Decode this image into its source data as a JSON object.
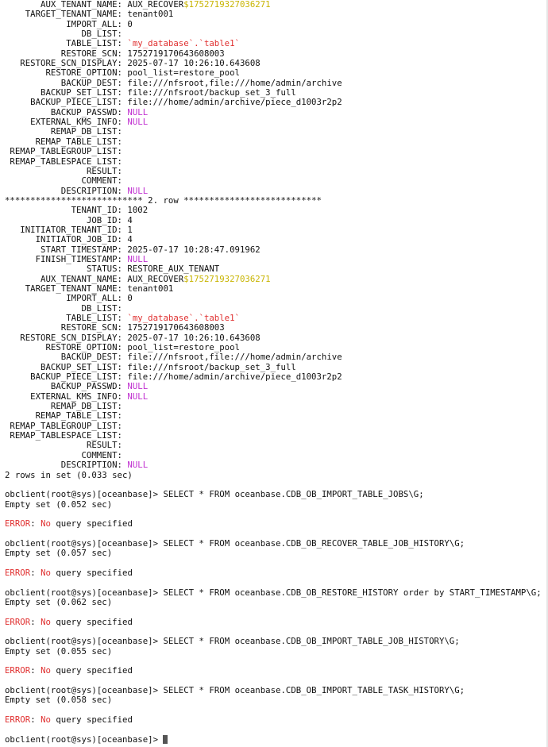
{
  "terminal": {
    "row_sep_left": "***************************",
    "row_sep_right": "***************************",
    "row_label": "2. row",
    "rows_in_set": "2 rows in set (0.033 sec)",
    "empty_label": "Empty set",
    "error_label": "ERROR",
    "error_tail_no": "No",
    "error_tail_rest": "query specified",
    "prompt": "obclient(root@sys)[oceanbase]>",
    "block1": [
      {
        "k": "AUX_TENANT_NAME:",
        "v": "AUX_RECOVER",
        "v2": "$1752719327036271"
      },
      {
        "k": "TARGET_TENANT_NAME:",
        "v": "tenant001"
      },
      {
        "k": "IMPORT_ALL:",
        "v": "0"
      },
      {
        "k": "DB_LIST:",
        "v": ""
      },
      {
        "k": "TABLE_LIST:",
        "v": "`my_database`.`table1`",
        "style": "red"
      },
      {
        "k": "RESTORE_SCN:",
        "v": "1752719170643608003"
      },
      {
        "k": "RESTORE_SCN_DISPLAY:",
        "v": "2025-07-17 10:26:10.643608"
      },
      {
        "k": "RESTORE_OPTION:",
        "v": "pool_list=restore_pool"
      },
      {
        "k": "BACKUP_DEST:",
        "v": "file:///nfsroot,file:///home/admin/archive"
      },
      {
        "k": "BACKUP_SET_LIST:",
        "v": "file:///nfsroot/backup_set_3_full"
      },
      {
        "k": "BACKUP_PIECE_LIST:",
        "v": "file:///home/admin/archive/piece_d1003r2p2"
      },
      {
        "k": "BACKUP_PASSWD:",
        "v": "NULL",
        "style": "mag"
      },
      {
        "k": "EXTERNAL_KMS_INFO:",
        "v": "NULL",
        "style": "mag"
      },
      {
        "k": "REMAP_DB_LIST:",
        "v": ""
      },
      {
        "k": "REMAP_TABLE_LIST:",
        "v": ""
      },
      {
        "k": "REMAP_TABLEGROUP_LIST:",
        "v": ""
      },
      {
        "k": "REMAP_TABLESPACE_LIST:",
        "v": ""
      },
      {
        "k": "RESULT:",
        "v": ""
      },
      {
        "k": "COMMENT:",
        "v": ""
      },
      {
        "k": "DESCRIPTION:",
        "v": "NULL",
        "style": "mag"
      }
    ],
    "block2": [
      {
        "k": "TENANT_ID:",
        "v": "1002"
      },
      {
        "k": "JOB_ID:",
        "v": "4"
      },
      {
        "k": "INITIATOR_TENANT_ID:",
        "v": "1"
      },
      {
        "k": "INITIATOR_JOB_ID:",
        "v": "4"
      },
      {
        "k": "START_TIMESTAMP:",
        "v": "2025-07-17 10:28:47.091962"
      },
      {
        "k": "FINISH_TIMESTAMP:",
        "v": "NULL",
        "style": "mag"
      },
      {
        "k": "STATUS:",
        "v": "RESTORE_AUX_TENANT"
      },
      {
        "k": "AUX_TENANT_NAME:",
        "v": "AUX_RECOVER",
        "v2": "$1752719327036271"
      },
      {
        "k": "TARGET_TENANT_NAME:",
        "v": "tenant001"
      },
      {
        "k": "IMPORT_ALL:",
        "v": "0"
      },
      {
        "k": "DB_LIST:",
        "v": ""
      },
      {
        "k": "TABLE_LIST:",
        "v": "`my_database`.`table1`",
        "style": "red"
      },
      {
        "k": "RESTORE_SCN:",
        "v": "1752719170643608003"
      },
      {
        "k": "RESTORE_SCN_DISPLAY:",
        "v": "2025-07-17 10:26:10.643608"
      },
      {
        "k": "RESTORE_OPTION:",
        "v": "pool_list=restore_pool"
      },
      {
        "k": "BACKUP_DEST:",
        "v": "file:///nfsroot,file:///home/admin/archive"
      },
      {
        "k": "BACKUP_SET_LIST:",
        "v": "file:///nfsroot/backup_set_3_full"
      },
      {
        "k": "BACKUP_PIECE_LIST:",
        "v": "file:///home/admin/archive/piece_d1003r2p2"
      },
      {
        "k": "BACKUP_PASSWD:",
        "v": "NULL",
        "style": "mag"
      },
      {
        "k": "EXTERNAL_KMS_INFO:",
        "v": "NULL",
        "style": "mag"
      },
      {
        "k": "REMAP_DB_LIST:",
        "v": ""
      },
      {
        "k": "REMAP_TABLE_LIST:",
        "v": ""
      },
      {
        "k": "REMAP_TABLEGROUP_LIST:",
        "v": ""
      },
      {
        "k": "REMAP_TABLESPACE_LIST:",
        "v": ""
      },
      {
        "k": "RESULT:",
        "v": ""
      },
      {
        "k": "COMMENT:",
        "v": ""
      },
      {
        "k": "DESCRIPTION:",
        "v": "NULL",
        "style": "mag"
      }
    ],
    "queries": [
      {
        "command": "SELECT * FROM oceanbase.CDB_OB_IMPORT_TABLE_JOBS\\G;",
        "time": "(0.052 sec)"
      },
      {
        "command": "SELECT * FROM oceanbase.CDB_OB_RECOVER_TABLE_JOB_HISTORY\\G;",
        "time": "(0.057 sec)"
      },
      {
        "command": "SELECT * FROM oceanbase.CDB_OB_RESTORE_HISTORY order by START_TIMESTAMP\\G;",
        "time": "(0.062 sec)"
      },
      {
        "command": "SELECT * FROM oceanbase.CDB_OB_IMPORT_TABLE_JOB_HISTORY\\G;",
        "time": "(0.055 sec)"
      },
      {
        "command": "SELECT * FROM oceanbase.CDB_OB_IMPORT_TABLE_TASK_HISTORY\\G;",
        "time": "(0.058 sec)"
      }
    ],
    "colors": {
      "background": "#ffffff",
      "text": "#111111",
      "yellow": "#c8b400",
      "red": "#e03030",
      "magenta": "#c030d0"
    }
  }
}
